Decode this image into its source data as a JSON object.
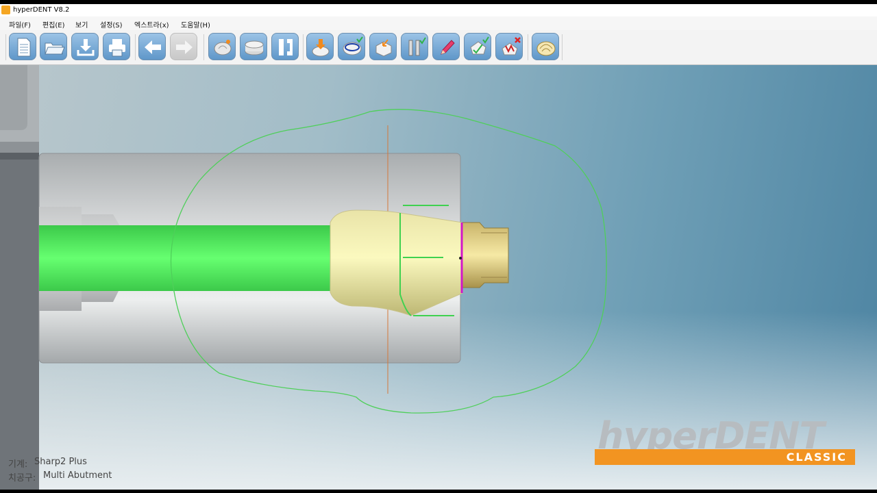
{
  "window": {
    "title": "hyperDENT V8.2"
  },
  "menu": [
    {
      "label": "파일(F)"
    },
    {
      "label": "편집(E)"
    },
    {
      "label": "보기"
    },
    {
      "label": "설정(S)"
    },
    {
      "label": "엑스트라(x)"
    },
    {
      "label": "도움말(H)"
    }
  ],
  "toolbar": [
    {
      "icon": "new-document-icon"
    },
    {
      "icon": "open-folder-icon"
    },
    {
      "icon": "save-download-icon"
    },
    {
      "icon": "print-icon"
    },
    {
      "icon": "back-arrow-icon"
    },
    {
      "icon": "forward-arrow-icon",
      "disabled": true
    },
    {
      "icon": "insert-tooth-icon"
    },
    {
      "icon": "blank-disc-icon"
    },
    {
      "icon": "fixture-holder-icon"
    },
    {
      "icon": "tooth-import-icon"
    },
    {
      "icon": "tooth-margin-icon"
    },
    {
      "icon": "tooth-position-icon"
    },
    {
      "icon": "tool-check-icon"
    },
    {
      "icon": "pen-edit-icon"
    },
    {
      "icon": "tooth-approve-icon"
    },
    {
      "icon": "tooth-delete-icon"
    },
    {
      "icon": "calculate-crown-icon"
    }
  ],
  "status": {
    "machine_label": "기계:",
    "machine_value": "Sharp2 Plus",
    "tool_label": "치공구:",
    "tool_value": "Multi Abutment"
  },
  "logo": {
    "word": "hyperDENT",
    "sub": "CLASSIC"
  },
  "colors": {
    "accent_orange": "#f29421",
    "green_highlight": "#5ef06a",
    "abutment_yellow": "#ecea9e",
    "margin_magenta": "#d316c8"
  }
}
